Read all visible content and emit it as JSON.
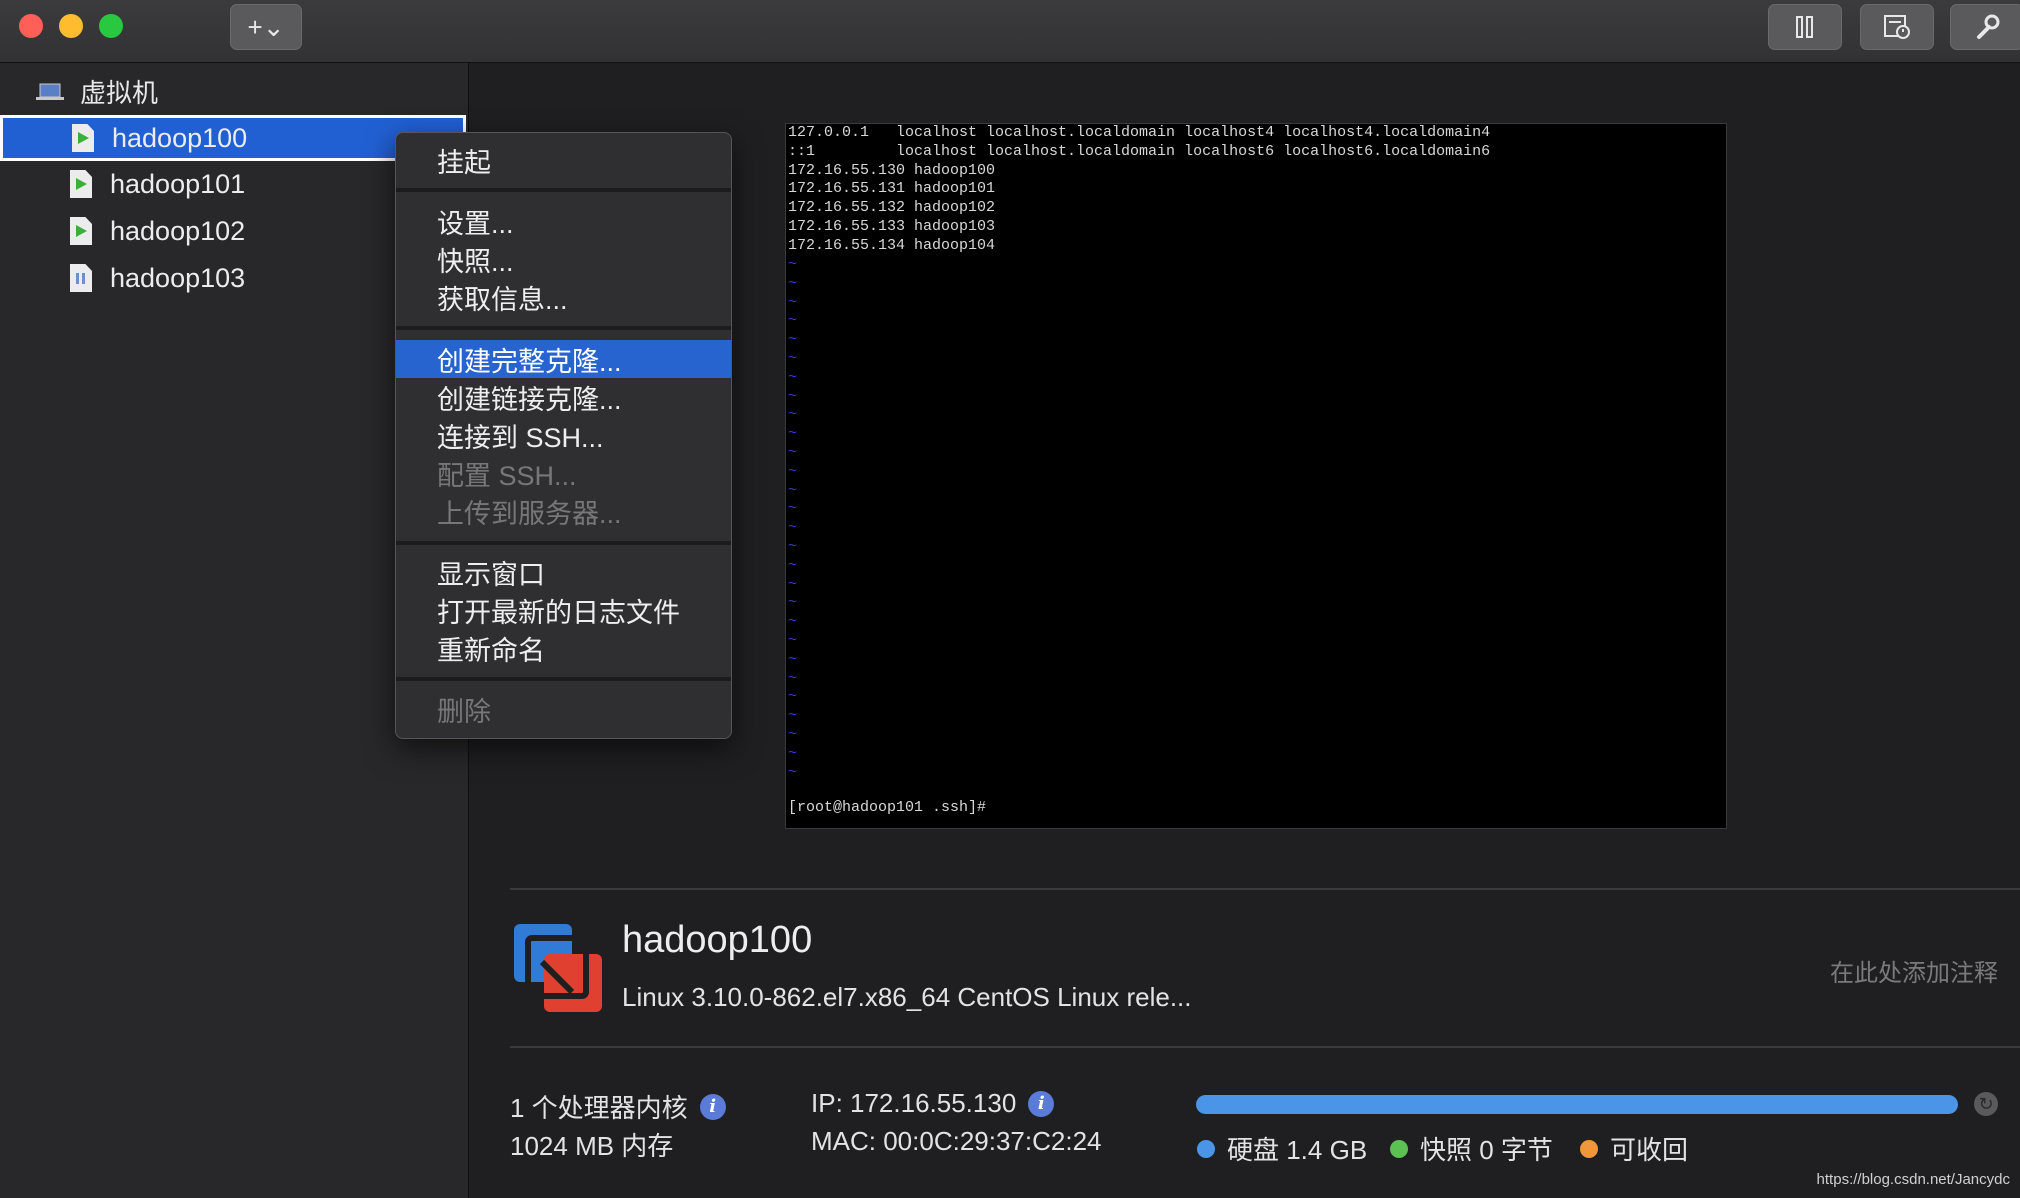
{
  "toolbar": {
    "add_button_label": "+⌄",
    "colors": {
      "close": "#fe5f57",
      "minimize": "#febc2e",
      "zoom": "#28c840"
    }
  },
  "sidebar": {
    "header": "虚拟机",
    "items": [
      {
        "label": "hadoop100",
        "state": "running",
        "selected": true
      },
      {
        "label": "hadoop101",
        "state": "running",
        "selected": false
      },
      {
        "label": "hadoop102",
        "state": "running",
        "selected": false
      },
      {
        "label": "hadoop103",
        "state": "paused",
        "selected": false
      }
    ]
  },
  "context_menu": {
    "groups": [
      [
        {
          "label": "挂起",
          "enabled": true
        }
      ],
      [
        {
          "label": "设置...",
          "enabled": true
        },
        {
          "label": "快照...",
          "enabled": true
        },
        {
          "label": "获取信息...",
          "enabled": true
        }
      ],
      [
        {
          "label": "创建完整克隆...",
          "enabled": true,
          "highlighted": true
        },
        {
          "label": "创建链接克隆...",
          "enabled": true
        },
        {
          "label": "连接到 SSH...",
          "enabled": true
        },
        {
          "label": "配置 SSH...",
          "enabled": false
        },
        {
          "label": "上传到服务器...",
          "enabled": false
        }
      ],
      [
        {
          "label": "显示窗口",
          "enabled": true
        },
        {
          "label": "打开最新的日志文件",
          "enabled": true
        },
        {
          "label": "重新命名",
          "enabled": true
        }
      ],
      [
        {
          "label": "删除",
          "enabled": false
        }
      ]
    ]
  },
  "terminal": {
    "lines": [
      "127.0.0.1   localhost localhost.localdomain localhost4 localhost4.localdomain4",
      "::1         localhost localhost.localdomain localhost6 localhost6.localdomain6",
      "172.16.55.130 hadoop100",
      "172.16.55.131 hadoop101",
      "172.16.55.132 hadoop102",
      "172.16.55.133 hadoop103",
      "172.16.55.134 hadoop104"
    ],
    "tilde_count": 28,
    "prompt": "[root@hadoop101 .ssh]#"
  },
  "vm_info": {
    "name": "hadoop100",
    "os": "Linux 3.10.0-862.el7.x86_64 CentOS Linux rele...",
    "notes_placeholder": "在此处添加注释",
    "cpu": "1 个处理器内核",
    "memory": "1024 MB 内存",
    "ip": "IP: 172.16.55.130",
    "mac": "MAC: 00:0C:29:37:C2:24",
    "storage": [
      {
        "label": "硬盘  1.4 GB",
        "color": "#4b95e8"
      },
      {
        "label": "快照  0 字节",
        "color": "#5cc052"
      },
      {
        "label": "可收回",
        "color": "#f0963c"
      }
    ],
    "storage_fill": 1.0
  },
  "watermark": "https://blog.csdn.net/Jancydc"
}
